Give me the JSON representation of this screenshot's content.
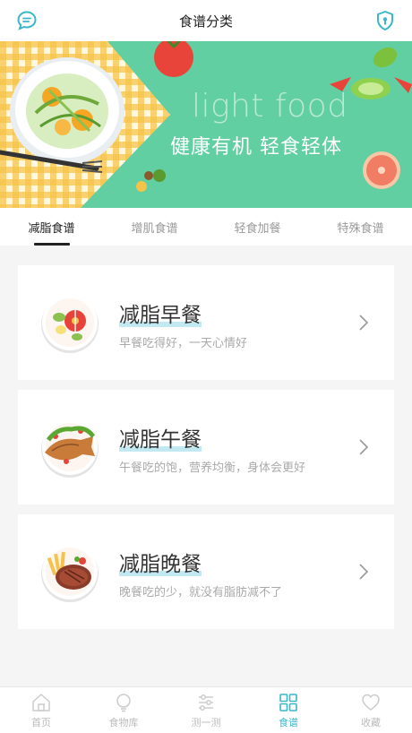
{
  "header": {
    "title": "食谱分类",
    "left_icon": "chat-bubble-icon",
    "right_icon": "shield-icon",
    "accent": "#3ab8c8"
  },
  "banner": {
    "tagline_en": "light food",
    "tagline_cn": "健康有机 轻食轻体",
    "background": "#62cfa3"
  },
  "tabs": [
    {
      "label": "减脂食谱",
      "active": true
    },
    {
      "label": "增肌食谱",
      "active": false
    },
    {
      "label": "轻食加餐",
      "active": false
    },
    {
      "label": "特殊食谱",
      "active": false
    }
  ],
  "cards": [
    {
      "title": "减脂早餐",
      "subtitle": "早餐吃得好，一天心情好",
      "icon": "breakfast-plate-icon"
    },
    {
      "title": "减脂午餐",
      "subtitle": "午餐吃的饱，营养均衡，身体会更好",
      "icon": "fish-plate-icon"
    },
    {
      "title": "减脂晚餐",
      "subtitle": "晚餐吃的少，就没有脂肪减不了",
      "icon": "steak-plate-icon"
    }
  ],
  "bottom_nav": [
    {
      "label": "首页",
      "icon": "home-icon",
      "active": false
    },
    {
      "label": "食物库",
      "icon": "bulb-icon",
      "active": false
    },
    {
      "label": "测一测",
      "icon": "sliders-icon",
      "active": false
    },
    {
      "label": "食谱",
      "icon": "grid-icon",
      "active": true
    },
    {
      "label": "收藏",
      "icon": "heart-icon",
      "active": false
    }
  ]
}
